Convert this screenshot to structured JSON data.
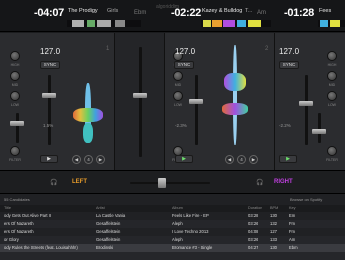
{
  "app": {
    "brand": "algoriddim"
  },
  "decks": [
    {
      "time": "-04:07",
      "artist": "The Prodigy",
      "title": "Girls",
      "key": "Ebm",
      "bpm": "127.0",
      "pitch": "1.5%",
      "number": "1",
      "playing": false
    },
    {
      "time": "-02:22",
      "artist": "Kazey & Bulldog",
      "title": "T...",
      "key": "Am",
      "bpm": "127.0",
      "pitch": "-2.3%",
      "number": "2",
      "playing": true
    },
    {
      "time": "-01:28",
      "artist": "Fees",
      "title": "",
      "key": "",
      "bpm": "127.0",
      "pitch": "-2.2%",
      "number": "3",
      "playing": true
    }
  ],
  "labels": {
    "sync": "SYNC",
    "high": "HIGH",
    "mid": "MID",
    "low": "LOW",
    "filter": "FILTER",
    "gain": "GAIN",
    "play": "▶",
    "loop_left": "◀",
    "loop_right": "▶",
    "loop_size": "4"
  },
  "mixbar": {
    "left": "LEFT",
    "right": "RIGHT"
  },
  "library": {
    "tab_left": "55 Candidates",
    "tab_right": "Browse on Spotify",
    "headers": [
      "Title",
      "Artist",
      "Album",
      "Duration",
      "BPM",
      "Key"
    ],
    "rows": [
      [
        "ody Gets Out Alive Part II",
        "La Castle Vania",
        "Feels Like Fire - EP",
        "03:28",
        "130",
        "Em"
      ],
      [
        "ers Of Nazareth",
        "Gesaffelstein",
        "Aleph",
        "03:26",
        "132",
        "Fm"
      ],
      [
        "ers Of Nazareth",
        "Gesaffelstein",
        "I Love Techno 2013",
        "04:08",
        "127",
        "Fm"
      ],
      [
        "or Glory",
        "Gesaffelstein",
        "Aleph",
        "03:26",
        "133",
        "Am"
      ],
      [
        "ody Rules the Streets (feat. Louisahhh!)",
        "Brodinski",
        "Bromance #3 - Single",
        "04:27",
        "130",
        "Ebm"
      ],
      [
        "",
        "",
        "",
        "",
        "",
        ""
      ]
    ]
  }
}
